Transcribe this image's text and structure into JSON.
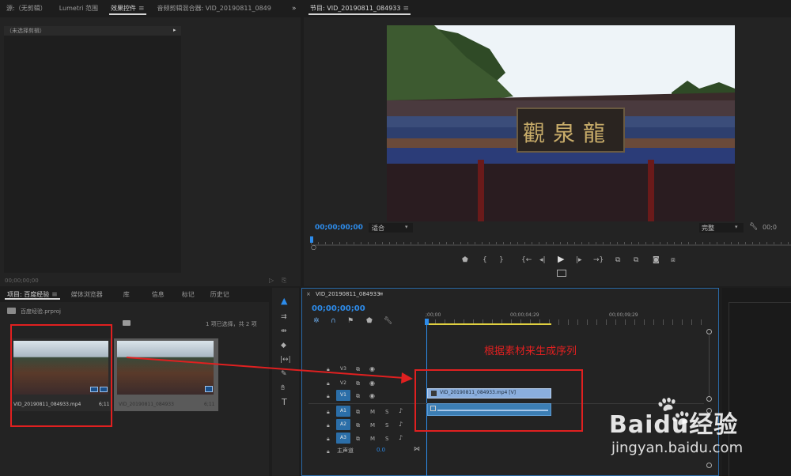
{
  "source_panel": {
    "tabs": [
      {
        "label": "源:（无剪辑）"
      },
      {
        "label": "Lumetri 范围"
      },
      {
        "label": "效果控件",
        "active": true
      },
      {
        "label": "音频剪辑混合器: VID_20190811_0849"
      }
    ],
    "no_clip_label": "（未选择剪辑）",
    "timecode": "00;00;00;00"
  },
  "program_monitor": {
    "title": "节目: VID_20190811_084933",
    "timecode": "00;00;00;00",
    "fit_label": "适合",
    "quality_label": "完整",
    "sign_text": "觀泉龍"
  },
  "project_panel": {
    "tabs": [
      {
        "label": "项目: 百度经验",
        "active": true
      },
      {
        "label": "媒体浏览器"
      },
      {
        "label": "库"
      },
      {
        "label": "信息"
      },
      {
        "label": "标记"
      },
      {
        "label": "历史记"
      }
    ],
    "project_file": "百度经验.prproj",
    "selection_status": "1 项已选择，共 2 项",
    "items": [
      {
        "name": "VID_20190811_084933.mp4",
        "duration": "6;11"
      },
      {
        "name": "VID_20190811_084933",
        "duration": "6;11"
      }
    ]
  },
  "timeline": {
    "title": "VID_20190811_084933",
    "timecode": "00;00;00;00",
    "ruler": [
      ";00;00",
      "00;00;04;29",
      "00;00;09;29"
    ],
    "video_tracks": [
      "V3",
      "V2",
      "V1"
    ],
    "audio_tracks": [
      "A1",
      "A2",
      "A3"
    ],
    "master_label": "主声道",
    "master_value": "0.0",
    "clip_label": "VID_20190811_084933.mp4 [V]",
    "mute_label": "M",
    "solo_label": "S"
  },
  "annotation": {
    "text": "根据素材来生成序列",
    "color": "#e02020"
  },
  "watermark": {
    "brand": "Baidu经验",
    "url": "jingyan.baidu.com"
  },
  "colors": {
    "accent": "#2d8ceb",
    "annotation": "#e02020",
    "clip_video": "#8aaedd",
    "clip_audio": "#3c7eb4"
  }
}
